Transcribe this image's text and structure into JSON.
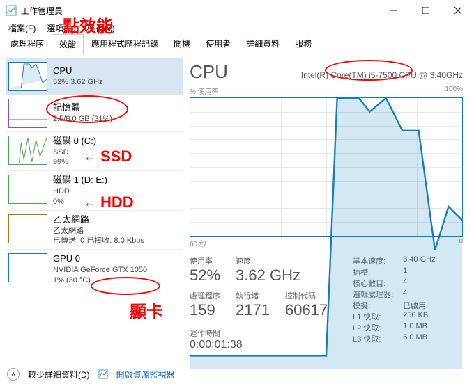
{
  "window": {
    "title": "工作管理員",
    "menu": {
      "file": "檔案(F)",
      "options": "選項(O)",
      "view": "檢視(V)"
    },
    "controls": {
      "min": "minimize",
      "max": "maximize",
      "close": "close"
    }
  },
  "tabs": [
    "處理程序",
    "效能",
    "應用程式歷程記錄",
    "開機",
    "使用者",
    "詳細資料",
    "服務"
  ],
  "active_tab": 1,
  "sidebar": {
    "items": [
      {
        "title": "CPU",
        "sub1": "52% 3.62 GHz",
        "sub2": "",
        "color": "#117dbb"
      },
      {
        "title": "記憶體",
        "sub1": "2.5/8.0 GB (31%)",
        "sub2": "",
        "color": "#9b4f96"
      },
      {
        "title": "磁碟 0 (C:)",
        "sub1": "SSD",
        "sub2": "99%",
        "color": "#4ca64c"
      },
      {
        "title": "磁碟 1 (D: E:)",
        "sub1": "HDD",
        "sub2": "0%",
        "color": "#4ca64c"
      },
      {
        "title": "乙太網路",
        "sub1": "乙太網路",
        "sub2": "已傳送: 0  已接收: 8.0 Kbps",
        "color": "#a67c00"
      },
      {
        "title": "GPU 0",
        "sub1": "NVIDIA GeForce GTX 1050",
        "sub2": "1% (30 °C)",
        "color": "#117dbb"
      }
    ]
  },
  "main": {
    "heading": "CPU",
    "cpu_name": "Intel(R) Core(TM) i5-7500 CPU @ 3.40GHz",
    "y_axis_label": "% 使用率",
    "y_max": "100%",
    "x_left": "60 秒",
    "x_right": "0",
    "stats_left": [
      {
        "lbl": "使用率",
        "val": "52%"
      },
      {
        "lbl": "速度",
        "val": "3.62 GHz"
      }
    ],
    "stats_bottom": [
      {
        "lbl": "處理程序",
        "val": "159"
      },
      {
        "lbl": "執行緒",
        "val": "2171"
      },
      {
        "lbl": "控制代碼",
        "val": "60617"
      }
    ],
    "uptime_label": "運作時間",
    "uptime_value": "0:00:01:38",
    "details": [
      {
        "k": "基本速度:",
        "v": "3.40 GHz"
      },
      {
        "k": "插槽:",
        "v": "1"
      },
      {
        "k": "核心數目:",
        "v": "4"
      },
      {
        "k": "邏輯處理器:",
        "v": "4"
      },
      {
        "k": "模擬:",
        "v": "已啟用"
      },
      {
        "k": "L1 快取:",
        "v": "256 KB"
      },
      {
        "k": "L2 快取:",
        "v": "1.0 MB"
      },
      {
        "k": "L3 快取:",
        "v": "6.0 MB"
      }
    ]
  },
  "footer": {
    "fewer": "較少詳細資料(D)",
    "resmon": "開啟資源監視器"
  },
  "annotations": {
    "tab_point": "點效能",
    "ssd": "SSD",
    "hdd": "HDD",
    "gpu": "顯卡"
  },
  "chart_data": {
    "type": "line",
    "title": "% 使用率",
    "xlabel": "秒",
    "ylabel": "%",
    "x": [
      60,
      55,
      50,
      45,
      40,
      35,
      30,
      25,
      20,
      15,
      10,
      5,
      0
    ],
    "values": [
      5,
      5,
      5,
      5,
      5,
      5,
      5,
      100,
      100,
      95,
      88,
      44,
      55
    ],
    "ylim": [
      0,
      100
    ],
    "xlim": [
      60,
      0
    ]
  }
}
